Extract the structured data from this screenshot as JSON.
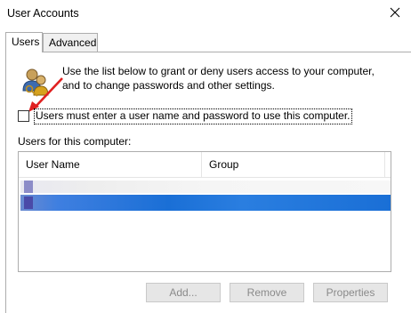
{
  "window": {
    "title": "User Accounts"
  },
  "tabs": [
    {
      "label": "Users"
    },
    {
      "label": "Advanced"
    }
  ],
  "description": "Use the list below to grant or deny users access to your computer, and to change passwords and other settings.",
  "must_enter_checkbox": {
    "label": "Users must enter a user name and password to use this computer.",
    "checked": false
  },
  "users_list": {
    "label": "Users for this computer:",
    "columns": [
      "User Name",
      "Group"
    ]
  },
  "buttons": {
    "add": "Add...",
    "remove": "Remove",
    "properties": "Properties"
  },
  "colors": {
    "selection": "#1a6fd6",
    "annotation_arrow": "#e02020"
  }
}
